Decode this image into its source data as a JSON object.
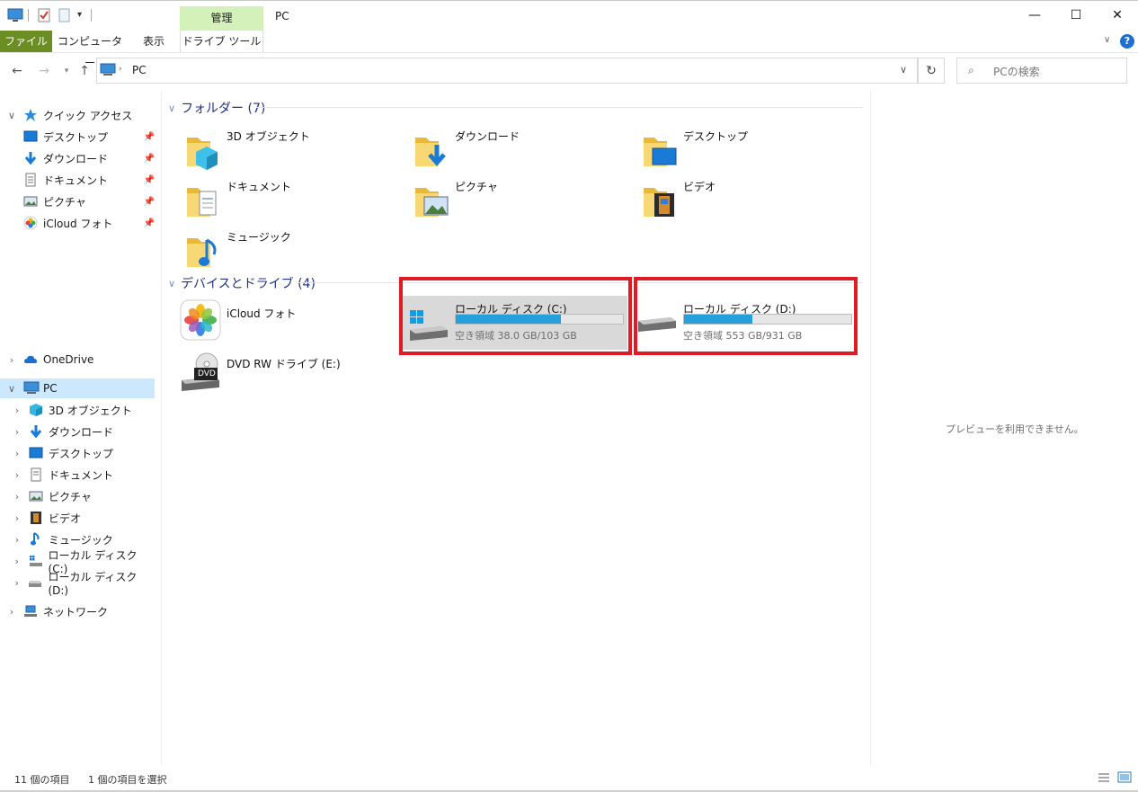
{
  "titlebar": {
    "context_tab": "管理",
    "title": "PC",
    "minimize": "—",
    "maximize": "☐",
    "close": "✕"
  },
  "ribbon": {
    "tabs": [
      "ファイル",
      "コンピューター",
      "表示",
      "ドライブ ツール"
    ]
  },
  "address": {
    "path": "PC",
    "search_placeholder": "PCの検索"
  },
  "nav": {
    "quick_access": "クイック アクセス",
    "quick_items": [
      "デスクトップ",
      "ダウンロード",
      "ドキュメント",
      "ピクチャ",
      "iCloud フォト"
    ],
    "onedrive": "OneDrive",
    "pc": "PC",
    "pc_items": [
      "3D オブジェクト",
      "ダウンロード",
      "デスクトップ",
      "ドキュメント",
      "ピクチャ",
      "ビデオ",
      "ミュージック",
      "ローカル ディスク (C:)",
      "ローカル ディスク (D:)"
    ],
    "network": "ネットワーク"
  },
  "content": {
    "folders_header": "フォルダー (7)",
    "folders": [
      "3D オブジェクト",
      "ダウンロード",
      "デスクトップ",
      "ドキュメント",
      "ピクチャ",
      "ビデオ",
      "ミュージック"
    ],
    "devices_header": "デバイスとドライブ (4)",
    "icloud": "iCloud フォト",
    "dvd": "DVD RW ドライブ (E:)",
    "dvd_badge": "DVD",
    "drive_c": {
      "name": "ローカル ディスク (C:)",
      "free_text": "空き領域 38.0 GB/103 GB",
      "used_fraction": 0.63,
      "selected": true
    },
    "drive_d": {
      "name": "ローカル ディスク (D:)",
      "free_text": "空き領域 553 GB/931 GB",
      "used_fraction": 0.41,
      "selected": false
    }
  },
  "preview": {
    "message": "プレビューを利用できません。"
  },
  "status": {
    "items": "11 個の項目",
    "selected": "1 個の項目を選択"
  },
  "colors": {
    "accent": "#26a0da",
    "highlight": "#e01b24",
    "file_tab": "#6a8e24",
    "context_tab": "#d3f1b9"
  }
}
